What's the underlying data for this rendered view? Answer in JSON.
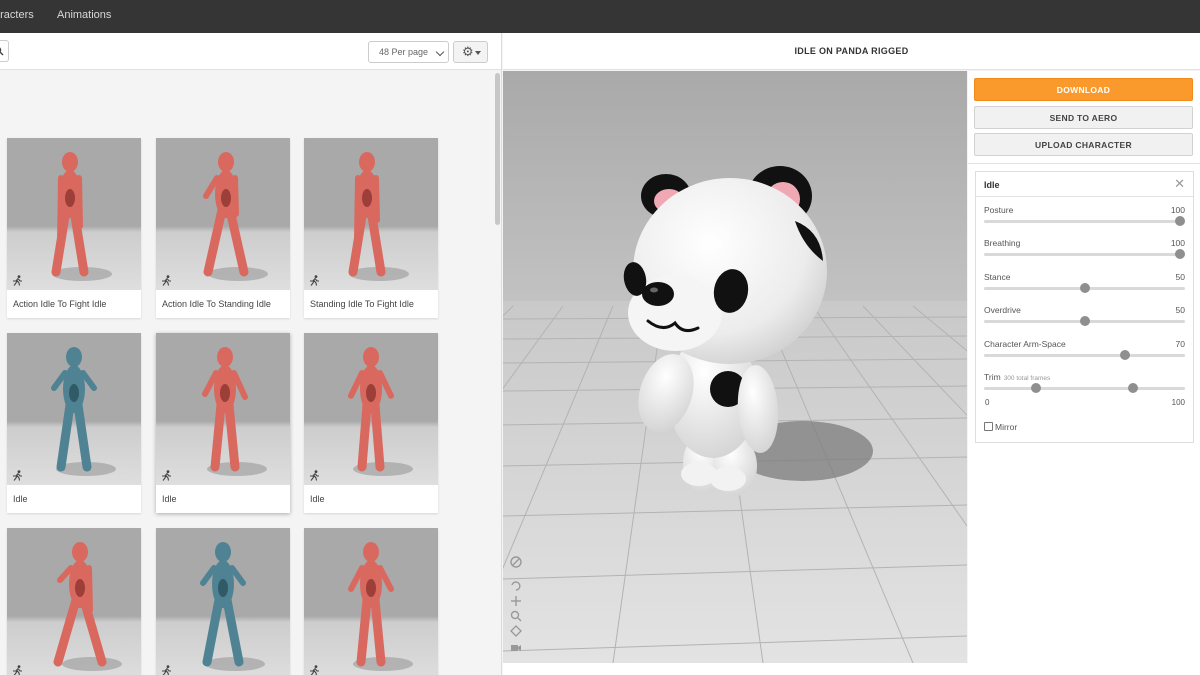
{
  "nav": {
    "characters": "aracters",
    "animations": "Animations"
  },
  "toolbar": {
    "per_page": "48 Per page",
    "search_icon": "search-icon",
    "settings_icon": "gear-icon"
  },
  "animations": [
    {
      "label": "Action Idle To Fight Idle",
      "model": "red"
    },
    {
      "label": "Action Idle To Standing Idle",
      "model": "red"
    },
    {
      "label": "Standing Idle To Fight Idle",
      "model": "red"
    },
    {
      "label": "Idle",
      "model": "blue"
    },
    {
      "label": "Idle",
      "model": "red",
      "selected": true
    },
    {
      "label": "Idle",
      "model": "red"
    },
    {
      "label": "",
      "model": "red"
    },
    {
      "label": "",
      "model": "blue"
    },
    {
      "label": "",
      "model": "red"
    }
  ],
  "viewport": {
    "title": "IDLE ON PANDA RIGGED"
  },
  "actions": {
    "download": "DOWNLOAD",
    "send_to_aero": "SEND TO AERO",
    "upload_character": "UPLOAD CHARACTER"
  },
  "settings": {
    "title": "Idle",
    "sliders": [
      {
        "label": "Posture",
        "value": "100",
        "fraction": 1.0
      },
      {
        "label": "Breathing",
        "value": "100",
        "fraction": 1.0
      },
      {
        "label": "Stance",
        "value": "50",
        "fraction": 0.5
      },
      {
        "label": "Overdrive",
        "value": "50",
        "fraction": 0.5
      },
      {
        "label": "Character Arm-Space",
        "value": "70",
        "fraction": 0.7
      }
    ],
    "trim": {
      "label": "Trim",
      "frames": "300 total frames",
      "min": "0",
      "max": "100",
      "start_fraction": 0.26,
      "end_fraction": 0.74
    },
    "mirror": "Mirror"
  },
  "colors": {
    "accent": "#fa9a2c",
    "red_model": "#d9695f",
    "blue_model": "#4f8393"
  }
}
